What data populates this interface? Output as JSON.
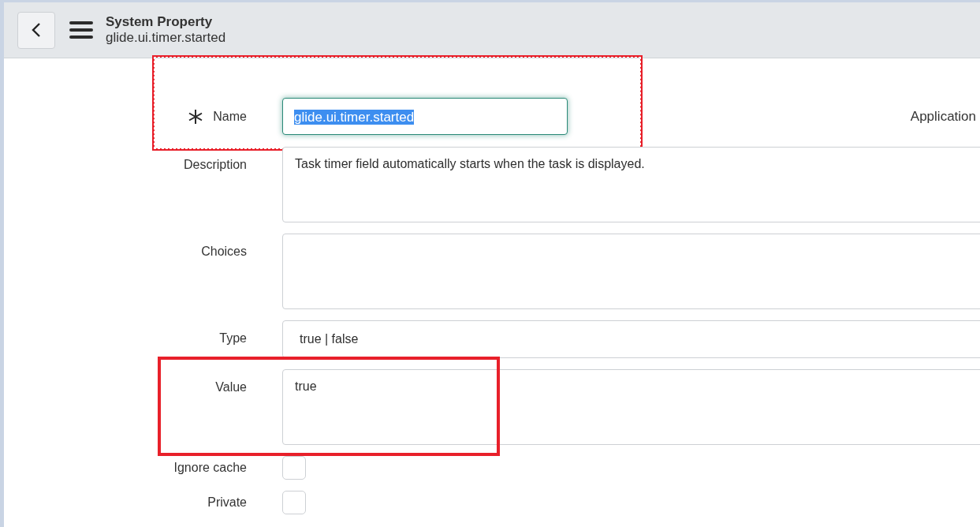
{
  "header": {
    "title": "System Property",
    "subtitle": "glide.ui.timer.started"
  },
  "fields": [
    {
      "kind": "text",
      "label": "Name",
      "required": true,
      "value": "glide.ui.timer.started",
      "focused": true,
      "text_selected": true,
      "highlighted": true,
      "dashed": true,
      "side_label": "Application"
    },
    {
      "kind": "textarea",
      "label": "Description",
      "value": "Task timer field automatically starts when the task is displayed.",
      "highlighted": false
    },
    {
      "kind": "textarea",
      "label": "Choices",
      "highlighted": false
    },
    {
      "kind": "select",
      "label": "Type",
      "value": "true | false",
      "highlighted": false
    },
    {
      "kind": "textarea",
      "label": "Value",
      "value": "true",
      "highlighted": true,
      "dashed": false
    },
    {
      "kind": "checkbox",
      "label": "Ignore cache",
      "checked": false,
      "highlighted": false
    },
    {
      "kind": "checkbox",
      "label": "Private",
      "checked": false,
      "highlighted": false
    }
  ]
}
